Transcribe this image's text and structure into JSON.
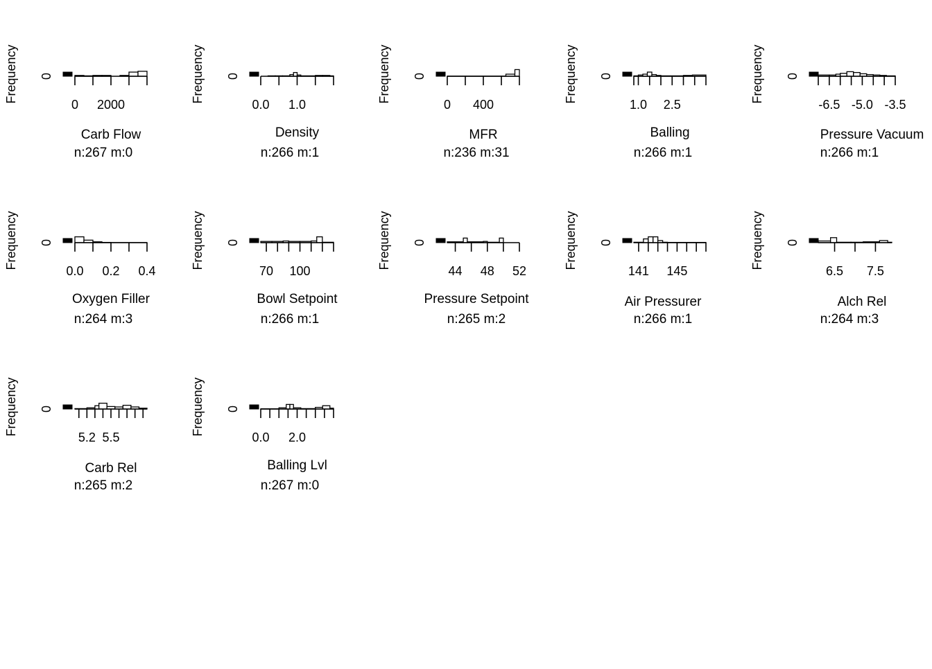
{
  "chart_data": [
    {
      "type": "bar",
      "title": "Carb Flow",
      "stats": "n:267 m:0",
      "ylabel": "Frequency",
      "y_ticks": [
        "0"
      ],
      "x_ticks": [
        {
          "v": 0,
          "label": "0"
        },
        {
          "v": 1000,
          "label": ""
        },
        {
          "v": 2000,
          "label": "2000"
        },
        {
          "v": 3000,
          "label": ""
        },
        {
          "v": 4000,
          "label": ""
        }
      ],
      "xlim": [
        0,
        4000
      ],
      "bins": [
        {
          "x0": 0,
          "x1": 500,
          "h": 0.1
        },
        {
          "x0": 500,
          "x1": 1000,
          "h": 0.05
        },
        {
          "x0": 1000,
          "x1": 1500,
          "h": 0.1
        },
        {
          "x0": 1500,
          "x1": 2000,
          "h": 0.1
        },
        {
          "x0": 2000,
          "x1": 2500,
          "h": 0.0
        },
        {
          "x0": 2500,
          "x1": 3000,
          "h": 0.1
        },
        {
          "x0": 3000,
          "x1": 3500,
          "h": 0.5
        },
        {
          "x0": 3500,
          "x1": 4000,
          "h": 0.6
        }
      ],
      "missing": 0.5
    },
    {
      "type": "bar",
      "title": "Density",
      "stats": "n:266 m:1",
      "ylabel": "Frequency",
      "y_ticks": [
        "0"
      ],
      "x_ticks": [
        {
          "v": 0,
          "label": "0.0"
        },
        {
          "v": 0.5,
          "label": ""
        },
        {
          "v": 1.0,
          "label": "1.0"
        },
        {
          "v": 1.5,
          "label": ""
        },
        {
          "v": 2.0,
          "label": ""
        }
      ],
      "xlim": [
        0,
        2.0
      ],
      "bins": [
        {
          "x0": 0.2,
          "x1": 0.4,
          "h": 0.05
        },
        {
          "x0": 0.4,
          "x1": 0.6,
          "h": 0.05
        },
        {
          "x0": 0.6,
          "x1": 0.8,
          "h": 0.05
        },
        {
          "x0": 0.8,
          "x1": 0.9,
          "h": 0.2
        },
        {
          "x0": 0.9,
          "x1": 1.0,
          "h": 0.45
        },
        {
          "x0": 1.0,
          "x1": 1.1,
          "h": 0.15
        },
        {
          "x0": 1.1,
          "x1": 1.5,
          "h": 0.05
        },
        {
          "x0": 1.5,
          "x1": 1.7,
          "h": 0.1
        },
        {
          "x0": 1.7,
          "x1": 1.9,
          "h": 0.1
        },
        {
          "x0": 1.9,
          "x1": 2.0,
          "h": 0.05
        }
      ],
      "missing": 0.5
    },
    {
      "type": "bar",
      "title": "MFR",
      "stats": "n:236 m:31",
      "ylabel": "Frequency",
      "y_ticks": [
        "0"
      ],
      "x_ticks": [
        {
          "v": 0,
          "label": "0"
        },
        {
          "v": 200,
          "label": ""
        },
        {
          "v": 400,
          "label": "400"
        },
        {
          "v": 600,
          "label": ""
        },
        {
          "v": 800,
          "label": ""
        }
      ],
      "xlim": [
        0,
        800
      ],
      "bins": [
        {
          "x0": 0,
          "x1": 650,
          "h": 0.02
        },
        {
          "x0": 650,
          "x1": 750,
          "h": 0.25
        },
        {
          "x0": 750,
          "x1": 800,
          "h": 0.8
        }
      ],
      "missing": 0.5
    },
    {
      "type": "bar",
      "title": "Balling",
      "stats": "n:266 m:1",
      "ylabel": "Frequency",
      "y_ticks": [
        "0"
      ],
      "x_ticks": [
        {
          "v": 0.8,
          "label": ""
        },
        {
          "v": 1.0,
          "label": "1.0"
        },
        {
          "v": 1.5,
          "label": ""
        },
        {
          "v": 2.0,
          "label": ""
        },
        {
          "v": 2.5,
          "label": "2.5"
        },
        {
          "v": 3.0,
          "label": ""
        },
        {
          "v": 3.5,
          "label": ""
        },
        {
          "v": 4.0,
          "label": ""
        }
      ],
      "xlim": [
        0.8,
        4.0
      ],
      "bins": [
        {
          "x0": 0.8,
          "x1": 1.0,
          "h": 0.05
        },
        {
          "x0": 1.0,
          "x1": 1.2,
          "h": 0.15
        },
        {
          "x0": 1.2,
          "x1": 1.4,
          "h": 0.25
        },
        {
          "x0": 1.4,
          "x1": 1.6,
          "h": 0.5
        },
        {
          "x0": 1.6,
          "x1": 1.8,
          "h": 0.2
        },
        {
          "x0": 1.8,
          "x1": 2.0,
          "h": 0.1
        },
        {
          "x0": 2.0,
          "x1": 3.0,
          "h": 0.05
        },
        {
          "x0": 3.0,
          "x1": 3.4,
          "h": 0.1
        },
        {
          "x0": 3.4,
          "x1": 4.0,
          "h": 0.15
        }
      ],
      "missing": 0.5
    },
    {
      "type": "bar",
      "title": "Pressure Vacuum",
      "stats": "n:266 m:1",
      "ylabel": "Frequency",
      "y_ticks": [
        "0"
      ],
      "x_ticks": [
        {
          "v": -7.0,
          "label": ""
        },
        {
          "v": -6.5,
          "label": "-6.5"
        },
        {
          "v": -6.0,
          "label": ""
        },
        {
          "v": -5.5,
          "label": ""
        },
        {
          "v": -5.0,
          "label": "-5.0"
        },
        {
          "v": -4.5,
          "label": ""
        },
        {
          "v": -4.0,
          "label": ""
        },
        {
          "v": -3.5,
          "label": "-3.5"
        }
      ],
      "xlim": [
        -7.0,
        -3.5
      ],
      "bins": [
        {
          "x0": -7.0,
          "x1": -6.5,
          "h": 0.15
        },
        {
          "x0": -6.5,
          "x1": -6.2,
          "h": 0.15
        },
        {
          "x0": -6.2,
          "x1": -6.0,
          "h": 0.25
        },
        {
          "x0": -6.0,
          "x1": -5.7,
          "h": 0.35
        },
        {
          "x0": -5.7,
          "x1": -5.4,
          "h": 0.55
        },
        {
          "x0": -5.4,
          "x1": -5.1,
          "h": 0.45
        },
        {
          "x0": -5.1,
          "x1": -4.8,
          "h": 0.3
        },
        {
          "x0": -4.8,
          "x1": -4.5,
          "h": 0.2
        },
        {
          "x0": -4.5,
          "x1": -4.2,
          "h": 0.15
        },
        {
          "x0": -4.2,
          "x1": -3.9,
          "h": 0.1
        },
        {
          "x0": -3.9,
          "x1": -3.5,
          "h": 0.05
        }
      ],
      "missing": 0.5
    },
    {
      "type": "bar",
      "title": "Oxygen Filler",
      "stats": "n:264 m:3",
      "ylabel": "Frequency",
      "y_ticks": [
        "0"
      ],
      "x_ticks": [
        {
          "v": 0,
          "label": "0.0"
        },
        {
          "v": 0.1,
          "label": ""
        },
        {
          "v": 0.2,
          "label": "0.2"
        },
        {
          "v": 0.3,
          "label": ""
        },
        {
          "v": 0.4,
          "label": "0.4"
        }
      ],
      "xlim": [
        0,
        0.4
      ],
      "bins": [
        {
          "x0": 0.0,
          "x1": 0.05,
          "h": 0.7
        },
        {
          "x0": 0.05,
          "x1": 0.1,
          "h": 0.3
        },
        {
          "x0": 0.1,
          "x1": 0.15,
          "h": 0.1
        },
        {
          "x0": 0.15,
          "x1": 0.2,
          "h": 0.03
        },
        {
          "x0": 0.2,
          "x1": 0.4,
          "h": 0.01
        }
      ],
      "missing": 0.5
    },
    {
      "type": "bar",
      "title": "Bowl Setpoint",
      "stats": "n:266 m:1",
      "ylabel": "Frequency",
      "y_ticks": [
        "0"
      ],
      "x_ticks": [
        {
          "v": 70,
          "label": "70"
        },
        {
          "v": 80,
          "label": ""
        },
        {
          "v": 90,
          "label": ""
        },
        {
          "v": 100,
          "label": "100"
        },
        {
          "v": 110,
          "label": ""
        },
        {
          "v": 120,
          "label": ""
        },
        {
          "v": 130,
          "label": ""
        }
      ],
      "xlim": [
        65,
        130
      ],
      "bins": [
        {
          "x0": 65,
          "x1": 75,
          "h": 0.15
        },
        {
          "x0": 75,
          "x1": 85,
          "h": 0.15
        },
        {
          "x0": 85,
          "x1": 90,
          "h": 0.2
        },
        {
          "x0": 90,
          "x1": 100,
          "h": 0.15
        },
        {
          "x0": 100,
          "x1": 110,
          "h": 0.15
        },
        {
          "x0": 110,
          "x1": 115,
          "h": 0.2
        },
        {
          "x0": 115,
          "x1": 120,
          "h": 0.7
        },
        {
          "x0": 120,
          "x1": 130,
          "h": 0.05
        }
      ],
      "missing": 0.5
    },
    {
      "type": "bar",
      "title": "Pressure Setpoint",
      "stats": "n:265 m:2",
      "ylabel": "Frequency",
      "y_ticks": [
        "0"
      ],
      "x_ticks": [
        {
          "v": 44,
          "label": "44"
        },
        {
          "v": 46,
          "label": ""
        },
        {
          "v": 48,
          "label": "48"
        },
        {
          "v": 50,
          "label": ""
        },
        {
          "v": 52,
          "label": "52"
        }
      ],
      "xlim": [
        43,
        52
      ],
      "bins": [
        {
          "x0": 43.0,
          "x1": 45.0,
          "h": 0.1
        },
        {
          "x0": 45.0,
          "x1": 45.5,
          "h": 0.55
        },
        {
          "x0": 45.5,
          "x1": 47.5,
          "h": 0.1
        },
        {
          "x0": 47.5,
          "x1": 48.0,
          "h": 0.15
        },
        {
          "x0": 48.0,
          "x1": 49.5,
          "h": 0.05
        },
        {
          "x0": 49.5,
          "x1": 50.0,
          "h": 0.55
        },
        {
          "x0": 50.0,
          "x1": 52.0,
          "h": 0.0
        }
      ],
      "missing": 0.5
    },
    {
      "type": "bar",
      "title": "Air Pressurer",
      "stats": "n:266 m:1",
      "ylabel": "Frequency",
      "y_ticks": [
        "0"
      ],
      "x_ticks": [
        {
          "v": 141,
          "label": "141"
        },
        {
          "v": 142,
          "label": ""
        },
        {
          "v": 143,
          "label": ""
        },
        {
          "v": 144,
          "label": ""
        },
        {
          "v": 145,
          "label": "145"
        },
        {
          "v": 146,
          "label": ""
        },
        {
          "v": 147,
          "label": ""
        },
        {
          "v": 148,
          "label": ""
        }
      ],
      "xlim": [
        140.5,
        148
      ],
      "bins": [
        {
          "x0": 140.5,
          "x1": 141.5,
          "h": 0.05
        },
        {
          "x0": 141.5,
          "x1": 142.0,
          "h": 0.45
        },
        {
          "x0": 142.0,
          "x1": 142.5,
          "h": 0.7
        },
        {
          "x0": 142.5,
          "x1": 143.0,
          "h": 0.7
        },
        {
          "x0": 143.0,
          "x1": 143.5,
          "h": 0.25
        },
        {
          "x0": 143.5,
          "x1": 144.0,
          "h": 0.05
        },
        {
          "x0": 144.0,
          "x1": 148.0,
          "h": 0.03
        }
      ],
      "missing": 0.5
    },
    {
      "type": "bar",
      "title": "Alch Rel",
      "stats": "n:264 m:3",
      "ylabel": "Frequency",
      "y_ticks": [
        "0"
      ],
      "x_ticks": [
        {
          "v": 6.5,
          "label": "6.5"
        },
        {
          "v": 7.0,
          "label": ""
        },
        {
          "v": 7.5,
          "label": "7.5"
        }
      ],
      "xlim": [
        6.1,
        7.9
      ],
      "bins": [
        {
          "x0": 6.1,
          "x1": 6.4,
          "h": 0.2
        },
        {
          "x0": 6.4,
          "x1": 6.55,
          "h": 0.6
        },
        {
          "x0": 6.55,
          "x1": 6.9,
          "h": 0.05
        },
        {
          "x0": 6.9,
          "x1": 7.2,
          "h": 0.05
        },
        {
          "x0": 7.2,
          "x1": 7.6,
          "h": 0.1
        },
        {
          "x0": 7.6,
          "x1": 7.8,
          "h": 0.25
        },
        {
          "x0": 7.8,
          "x1": 7.9,
          "h": 0.05
        }
      ],
      "missing": 0.5
    },
    {
      "type": "bar",
      "title": "Carb Rel",
      "stats": "n:265 m:2",
      "ylabel": "Frequency",
      "y_ticks": [
        "0"
      ],
      "x_ticks": [
        {
          "v": 5.1,
          "label": ""
        },
        {
          "v": 5.2,
          "label": "5.2"
        },
        {
          "v": 5.3,
          "label": ""
        },
        {
          "v": 5.4,
          "label": ""
        },
        {
          "v": 5.5,
          "label": "5.5"
        },
        {
          "v": 5.6,
          "label": ""
        },
        {
          "v": 5.7,
          "label": ""
        },
        {
          "v": 5.8,
          "label": ""
        },
        {
          "v": 5.9,
          "label": ""
        }
      ],
      "xlim": [
        5.05,
        5.95
      ],
      "bins": [
        {
          "x0": 5.05,
          "x1": 5.2,
          "h": 0.05
        },
        {
          "x0": 5.2,
          "x1": 5.3,
          "h": 0.15
        },
        {
          "x0": 5.3,
          "x1": 5.35,
          "h": 0.4
        },
        {
          "x0": 5.35,
          "x1": 5.45,
          "h": 0.7
        },
        {
          "x0": 5.45,
          "x1": 5.55,
          "h": 0.3
        },
        {
          "x0": 5.55,
          "x1": 5.65,
          "h": 0.25
        },
        {
          "x0": 5.65,
          "x1": 5.75,
          "h": 0.45
        },
        {
          "x0": 5.75,
          "x1": 5.85,
          "h": 0.25
        },
        {
          "x0": 5.85,
          "x1": 5.95,
          "h": 0.1
        }
      ],
      "missing": 0.5
    },
    {
      "type": "bar",
      "title": "Balling Lvl",
      "stats": "n:267 m:0",
      "ylabel": "Frequency",
      "y_ticks": [
        "0"
      ],
      "x_ticks": [
        {
          "v": 0.0,
          "label": "0.0"
        },
        {
          "v": 0.5,
          "label": ""
        },
        {
          "v": 1.0,
          "label": ""
        },
        {
          "v": 1.5,
          "label": ""
        },
        {
          "v": 2.0,
          "label": "2.0"
        },
        {
          "v": 2.5,
          "label": ""
        },
        {
          "v": 3.0,
          "label": ""
        },
        {
          "v": 3.5,
          "label": ""
        },
        {
          "v": 4.0,
          "label": ""
        }
      ],
      "xlim": [
        0,
        4.0
      ],
      "bins": [
        {
          "x0": 0.0,
          "x1": 1.0,
          "h": 0.03
        },
        {
          "x0": 1.0,
          "x1": 1.4,
          "h": 0.15
        },
        {
          "x0": 1.4,
          "x1": 1.6,
          "h": 0.55
        },
        {
          "x0": 1.6,
          "x1": 1.8,
          "h": 0.55
        },
        {
          "x0": 1.8,
          "x1": 2.2,
          "h": 0.15
        },
        {
          "x0": 2.2,
          "x1": 3.0,
          "h": 0.05
        },
        {
          "x0": 3.0,
          "x1": 3.4,
          "h": 0.2
        },
        {
          "x0": 3.4,
          "x1": 3.8,
          "h": 0.4
        },
        {
          "x0": 3.8,
          "x1": 4.0,
          "h": 0.1
        }
      ],
      "missing": 0.5
    }
  ]
}
